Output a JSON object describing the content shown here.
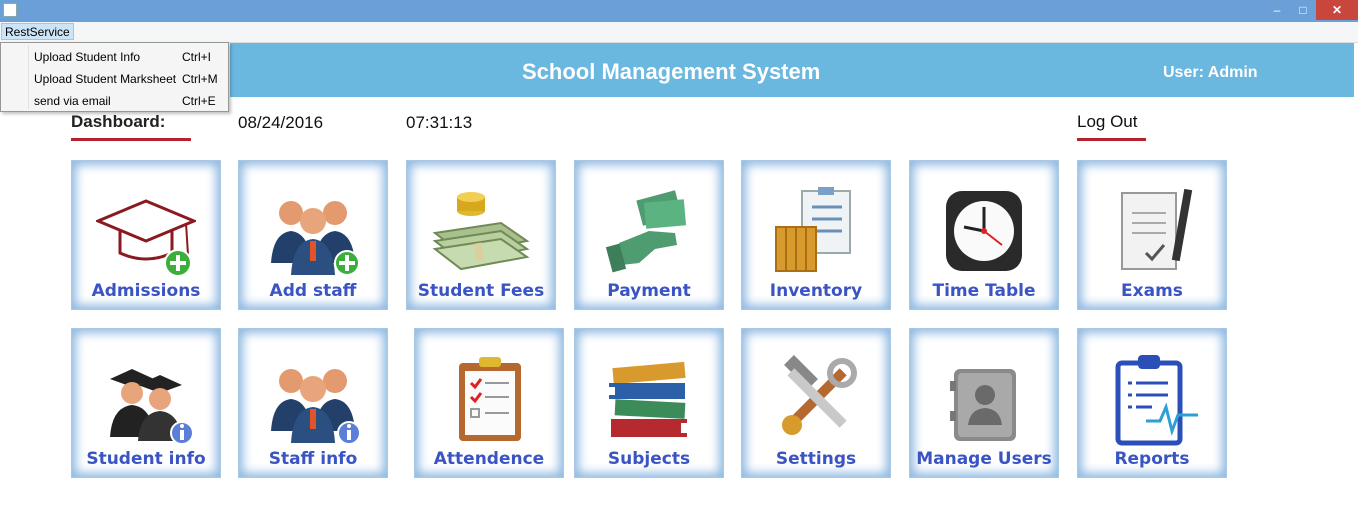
{
  "window": {
    "min_glyph": "–",
    "max_glyph": "□",
    "close_glyph": "✕"
  },
  "menubar": {
    "menu": "RestService"
  },
  "menu": {
    "items": [
      {
        "label": "Upload Student Info",
        "shortcut": "Ctrl+I"
      },
      {
        "label": "Upload Student Marksheet",
        "shortcut": "Ctrl+M"
      },
      {
        "label": "send via email",
        "shortcut": "Ctrl+E"
      }
    ]
  },
  "header": {
    "title": "School Management System",
    "user": "User: Admin"
  },
  "dashboard": {
    "label": "Dashboard:",
    "date": "08/24/2016",
    "time": "07:31:13",
    "logout": "Log Out"
  },
  "tiles": [
    {
      "label": "Admissions",
      "icon": "graduation-cap-add-icon"
    },
    {
      "label": "Add staff",
      "icon": "staff-add-icon"
    },
    {
      "label": "Student Fees",
      "icon": "money-stack-icon"
    },
    {
      "label": "Payment",
      "icon": "cash-hand-icon"
    },
    {
      "label": "Inventory",
      "icon": "clipboard-crate-icon"
    },
    {
      "label": "Time Table",
      "icon": "clock-icon"
    },
    {
      "label": "Exams",
      "icon": "exam-paper-pen-icon"
    },
    {
      "label": "Student info",
      "icon": "students-info-icon"
    },
    {
      "label": "Staff info",
      "icon": "staff-info-icon"
    },
    {
      "label": "Attendence",
      "icon": "checklist-clipboard-icon"
    },
    {
      "label": "Subjects",
      "icon": "books-stack-icon"
    },
    {
      "label": "Settings",
      "icon": "tools-icon"
    },
    {
      "label": "Manage Users",
      "icon": "user-folder-icon"
    },
    {
      "label": "Reports",
      "icon": "report-clipboard-icon"
    }
  ],
  "colors": {
    "banner": "#6ab7e0",
    "accent_underline": "#b5232e",
    "tile_label": "#3a54c4",
    "tile_border": "#8fb9e2"
  }
}
